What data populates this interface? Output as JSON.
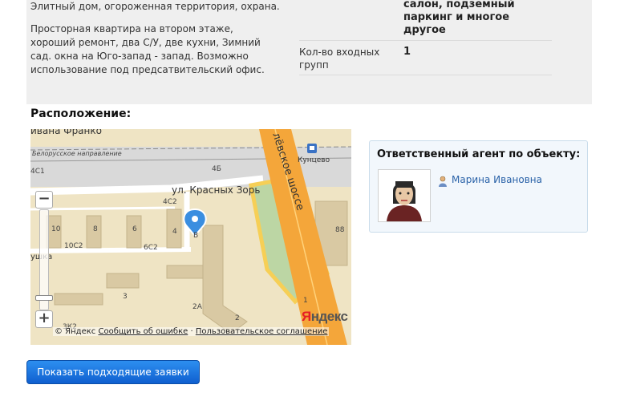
{
  "description": {
    "line1": "Элитный дом, огороженная территория, охрана.",
    "paragraph": "Просторная квартира на втором этаже, хороший ремонт, два С/У, две кухни, Зимний сад. окна на Юго-запад - запад. Возможно использование под предсатвительский офис."
  },
  "properties": {
    "row1_value_lines": [
      "салон, подземный",
      "паркинг и многое",
      "другое"
    ],
    "row2_label": "Кол-во входных групп",
    "row2_value": "1"
  },
  "location": {
    "title": "Расположение:",
    "map_labels": {
      "street_franko": "ивана Франко",
      "belorussky": "Белорусское направление",
      "station": "Кунцево",
      "highway": "лёвское шоссе",
      "street_krasnyh": "ул. Красных Зорь",
      "b4c1": "4С1",
      "b4b": "4Б",
      "b4c2": "4С2",
      "b10": "10",
      "b8": "8",
      "b6": "6",
      "b4": "4",
      "b10c2": "10С2",
      "b6c2": "6С2",
      "b3": "3",
      "b2a": "2А",
      "b2": "2",
      "b1": "1",
      "b88": "88",
      "b3k2": "3К2",
      "bB": "В",
      "street_left": "ушка"
    },
    "footer": {
      "copyright": "© Яндекс",
      "report_link": "Сообщить об ошибке",
      "separator": "·",
      "terms_link": "Пользовательское соглашение"
    },
    "logo": {
      "first": "Я",
      "rest": "ндекс"
    },
    "zoom_in": "+",
    "zoom_out": "−"
  },
  "agent": {
    "title": "Ответственный агент по объекту:",
    "name": "Марина Ивановна"
  },
  "actions": {
    "show_requests": "Показать подходящие заявки"
  },
  "colors": {
    "accent": "#1a73d9",
    "link": "#2a62a8",
    "panel_bg": "#efefef",
    "agent_box_bg": "#f2f7fc",
    "map_road": "#f4a63a"
  },
  "icons": {
    "agent": "person-icon",
    "map_pin": "map-pin-icon",
    "station": "train-station-icon"
  }
}
